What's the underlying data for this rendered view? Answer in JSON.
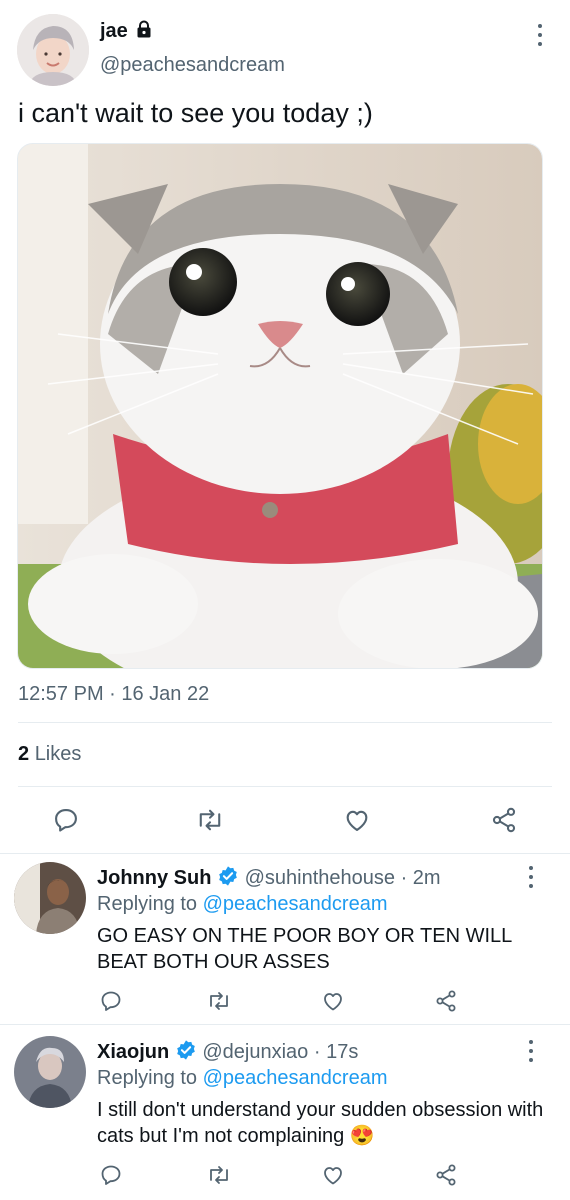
{
  "tweet": {
    "display_name": "jae",
    "handle": "@peachesandcream",
    "text": "i can't wait to see you today ;)",
    "timestamp": "12:57 PM · 16 Jan 22",
    "likes_count": "2",
    "likes_label": "Likes"
  },
  "replies": [
    {
      "display_name": "Johnny Suh",
      "handle": "@suhinthehouse",
      "time": "· 2m",
      "replying_prefix": "Replying to",
      "replying_to": "@peachesandcream",
      "text": "GO EASY ON THE POOR BOY OR TEN WILL BEAT BOTH OUR ASSES"
    },
    {
      "display_name": "Xiaojun",
      "handle": "@dejunxiao",
      "time": "· 17s",
      "replying_prefix": "Replying to",
      "replying_to": "@peachesandcream",
      "text": "I still don't understand your sudden obsession with cats but I'm not complaining",
      "emoji": "😍"
    }
  ],
  "icons": {
    "lock": "lock-icon",
    "verified": "verified-badge-icon",
    "reply": "reply-icon",
    "retweet": "retweet-icon",
    "like": "like-icon",
    "share": "share-icon",
    "more": "more-icon"
  },
  "colors": {
    "accent": "#1d9bf0",
    "secondary_text": "#536471",
    "divider": "#e6ecf0"
  }
}
